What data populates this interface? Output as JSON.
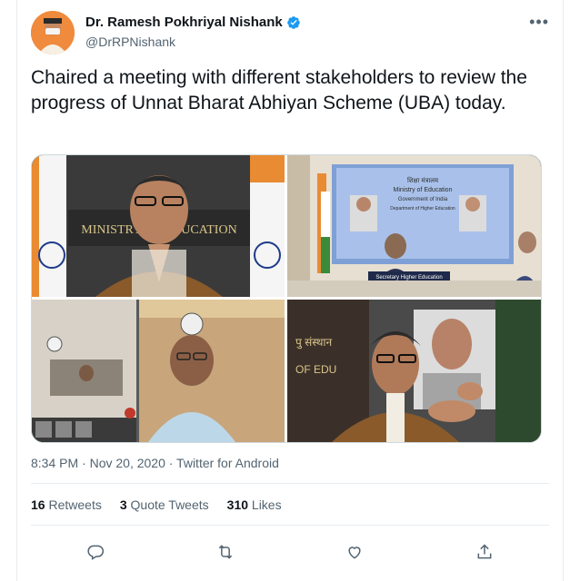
{
  "author": {
    "name": "Dr. Ramesh Pokhriyal Nishank",
    "handle": "@DrRPNishank"
  },
  "tweet": {
    "text": "Chaired a meeting with different stakeholders to review the progress of Unnat Bharat Abhiyan Scheme (UBA) today.",
    "timestamp": "8:34 PM · Nov 20, 2020 · Twitter for Android"
  },
  "media": {
    "panel_1_text": "MINISTRY OF EDUCATION",
    "panel_2_lines": [
      "शिक्षा मंत्रालय",
      "Ministry of Education",
      "Government of India",
      "Department of Higher Education"
    ],
    "panel_2_caption": "Secretary Higher Education",
    "panel_3_text": "पु संस्थान",
    "panel_3_text2": "OF EDU"
  },
  "stats": {
    "retweets_count": "16",
    "retweets_label": "Retweets",
    "quotes_count": "3",
    "quotes_label": "Quote Tweets",
    "likes_count": "310",
    "likes_label": "Likes"
  },
  "colors": {
    "verified": "#1d9bf0",
    "muted": "#536471",
    "divider": "#e6ecf0"
  },
  "icons": [
    "verified-badge-icon",
    "more-icon",
    "reply-icon",
    "retweet-icon",
    "like-icon",
    "share-icon"
  ]
}
